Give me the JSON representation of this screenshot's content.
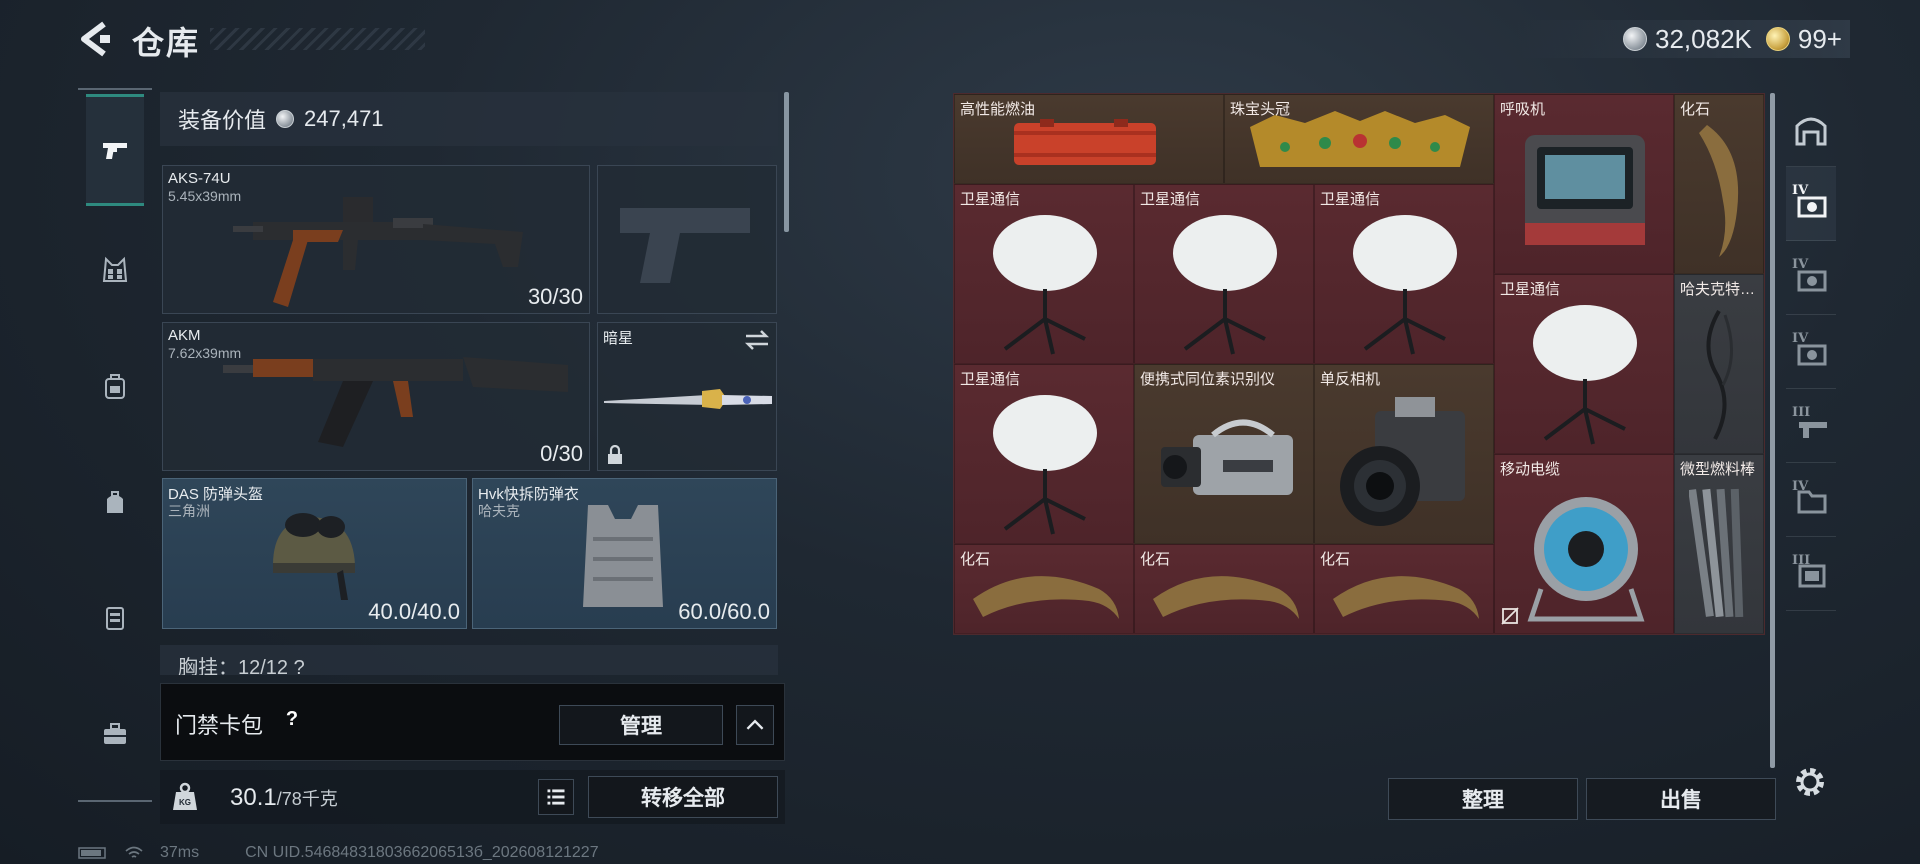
{
  "header": {
    "title": "仓库",
    "currency_silver": "32,082K",
    "currency_gold": "99+"
  },
  "left_nav": {
    "items": [
      "pistol-icon",
      "ammo-vest-icon",
      "backpack-icon",
      "bag-icon",
      "locker-icon",
      "briefcase-icon"
    ]
  },
  "loadout": {
    "equip_value_label": "装备价值",
    "equip_value": "247,471",
    "primary": {
      "name": "AKS-74U",
      "caliber": "5.45x39mm",
      "ammo": "30/30"
    },
    "secondary": {
      "name": "AKM",
      "caliber": "7.62x39mm",
      "ammo": "0/30"
    },
    "melee": {
      "name": "暗星"
    },
    "helmet": {
      "name": "DAS 防弹头盔",
      "faction": "三角洲",
      "durability": "40.0/40.0"
    },
    "armor": {
      "name": "Hvk快拆防弹衣",
      "faction": "哈夫克",
      "durability": "60.0/60.0"
    },
    "chest_rig": "胸挂：12/12 ?"
  },
  "keycard": {
    "label": "门禁卡包",
    "help": "?",
    "manage": "管理"
  },
  "weight": {
    "current": "30.1",
    "max": "/78千克",
    "transfer_all": "转移全部"
  },
  "footer": {
    "ping": "37ms",
    "uid": "CN UID.5468483180366206513б_202608121227"
  },
  "stash": {
    "items": [
      {
        "label": "高性能燃油",
        "art": "fuel"
      },
      {
        "label": "珠宝头冠",
        "art": "crown"
      },
      {
        "label": "呼吸机",
        "art": "ventilator"
      },
      {
        "label": "化石",
        "art": "claw"
      },
      {
        "label": "卫星通信",
        "art": "dish"
      },
      {
        "label": "卫星通信",
        "art": "dish"
      },
      {
        "label": "卫星通信",
        "art": "dish"
      },
      {
        "label": "卫星通信",
        "art": "dish"
      },
      {
        "label": "哈夫克特…",
        "art": "cable"
      },
      {
        "label": "卫星通信",
        "art": "dish"
      },
      {
        "label": "便携式同位素识别仪",
        "art": "isotope"
      },
      {
        "label": "单反相机",
        "art": "camera"
      },
      {
        "label": "移动电缆",
        "art": "reel"
      },
      {
        "label": "微型燃料棒",
        "art": "rods"
      },
      {
        "label": "化石",
        "art": "claw-h"
      },
      {
        "label": "化石",
        "art": "claw-h"
      },
      {
        "label": "化石",
        "art": "claw-h"
      }
    ],
    "sort": "整理",
    "sell": "出售"
  },
  "right_nav": {
    "tiers": [
      "",
      "IV",
      "IV",
      "IV",
      "III",
      "IV",
      "III"
    ]
  }
}
